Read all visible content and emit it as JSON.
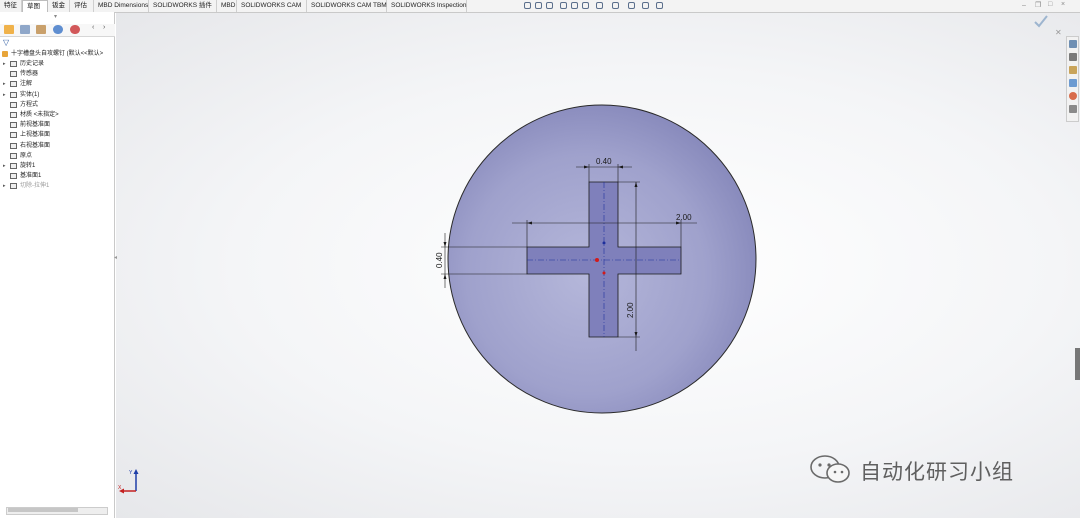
{
  "tabs": [
    {
      "label": "特征",
      "active": false
    },
    {
      "label": "草图",
      "active": true
    },
    {
      "label": "钣金",
      "active": false
    },
    {
      "label": "评估",
      "active": false
    },
    {
      "label": "MBD Dimensions",
      "active": false
    },
    {
      "label": "SOLIDWORKS 插件",
      "active": false
    },
    {
      "label": "MBD",
      "active": false
    },
    {
      "label": "SOLIDWORKS CAM",
      "active": false
    },
    {
      "label": "SOLIDWORKS CAM TBM",
      "active": false
    },
    {
      "label": "SOLIDWORKS Inspection",
      "active": false
    }
  ],
  "feature_tree": {
    "part_name": "十字槽盘头自攻螺钉 (默认<<默认>",
    "items": [
      {
        "label": "历史记录",
        "expandable": true,
        "grayed": false
      },
      {
        "label": "传感器",
        "expandable": false,
        "grayed": false
      },
      {
        "label": "注解",
        "expandable": true,
        "grayed": false
      },
      {
        "label": "实体(1)",
        "expandable": true,
        "grayed": false
      },
      {
        "label": "方程式",
        "expandable": false,
        "grayed": false
      },
      {
        "label": "材质 <未指定>",
        "expandable": false,
        "grayed": false
      },
      {
        "label": "前视基准面",
        "expandable": false,
        "grayed": false
      },
      {
        "label": "上视基准面",
        "expandable": false,
        "grayed": false
      },
      {
        "label": "右视基准面",
        "expandable": false,
        "grayed": false
      },
      {
        "label": "原点",
        "expandable": false,
        "grayed": false
      },
      {
        "label": "旋转1",
        "expandable": true,
        "grayed": false
      },
      {
        "label": "基准面1",
        "expandable": false,
        "grayed": false
      },
      {
        "label": "切除-拉伸1",
        "expandable": true,
        "grayed": true
      }
    ]
  },
  "sketch": {
    "dimensions": {
      "top_width": "0.40",
      "horizontal_length": "2.00",
      "left_height": "0.40",
      "vertical_length": "2.00"
    },
    "colors": {
      "disc": "#9a9cc8",
      "slot": "#7f80bb",
      "dim_line": "#1a1a1a",
      "centerline": "#1e2f9c",
      "origin": "#d21a1a"
    }
  },
  "watermark": {
    "text": "自动化研习小组"
  },
  "icons": [
    "feature-manager-icon",
    "property-manager-icon",
    "configuration-manager-icon",
    "dimxpert-icon",
    "display-manager-icon",
    "filter-icon",
    "triad-icon",
    "wechat-icon",
    "home-icon",
    "folder-icon",
    "appearance-icon",
    "view-palette-icon"
  ]
}
